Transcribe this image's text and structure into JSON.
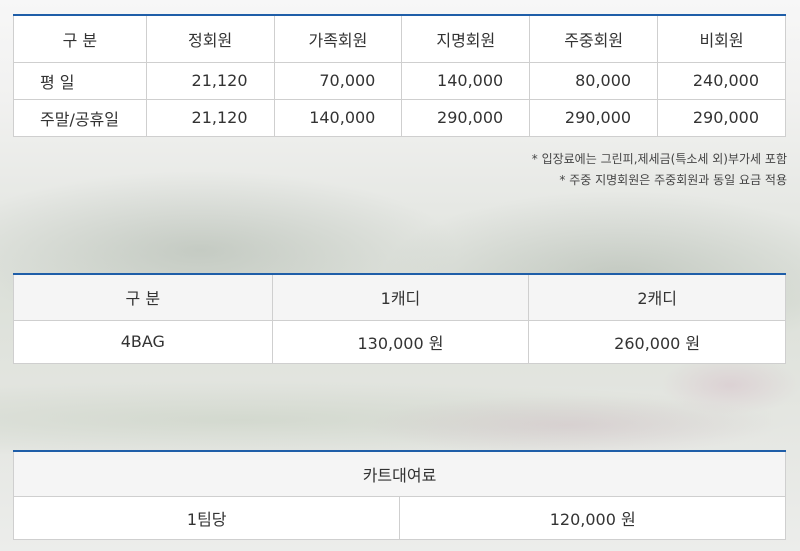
{
  "member_fees": {
    "headers": [
      "구 분",
      "정회원",
      "가족회원",
      "지명회원",
      "주중회원",
      "비회원"
    ],
    "rows": [
      {
        "label": "평 일",
        "values": [
          "21,120",
          "70,000",
          "140,000",
          "80,000",
          "240,000"
        ]
      },
      {
        "label": "주말/공휴일",
        "values": [
          "21,120",
          "140,000",
          "290,000",
          "290,000",
          "290,000"
        ]
      }
    ]
  },
  "notes": [
    "* 입장료에는 그린피,제세금(특소세 외)부가세 포함",
    "* 주중 지명회원은 주중회원과 동일 요금 적용"
  ],
  "caddie_fees": {
    "headers": [
      "구 분",
      "1캐디",
      "2캐디"
    ],
    "row": {
      "label": "4BAG",
      "values": [
        "130,000 원",
        "260,000 원"
      ]
    }
  },
  "cart_fees": {
    "title": "카트대여료",
    "row": {
      "label": "1팀당",
      "value": "120,000 원"
    }
  },
  "colors": {
    "accent_border": "#1f5ea8",
    "header_bg": "#f5f5f5"
  }
}
